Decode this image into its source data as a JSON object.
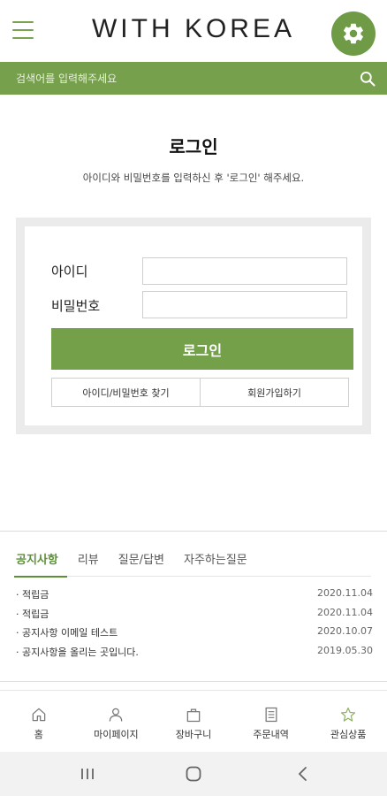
{
  "header": {
    "logo": "WITH KOREA"
  },
  "search": {
    "placeholder": "검색어를 입력해주세요"
  },
  "login": {
    "title": "로그인",
    "description": "아이디와 비밀번호를 입력하신 후 '로그인' 해주세요.",
    "id_label": "아이디",
    "password_label": "비밀번호",
    "button_label": "로그인",
    "find_link": "아이디/비밀번호 찾기",
    "signup_link": "회원가입하기"
  },
  "board": {
    "tabs": [
      {
        "label": "공지사항",
        "active": true
      },
      {
        "label": "리뷰"
      },
      {
        "label": "질문/답변"
      },
      {
        "label": "자주하는질문"
      }
    ],
    "notices": [
      {
        "title": "· 적립금",
        "date": "2020.11.04"
      },
      {
        "title": "· 적립금",
        "date": "2020.11.04"
      },
      {
        "title": "· 공지사항 이메일 테스트",
        "date": "2020.10.07"
      },
      {
        "title": "· 공지사항을 올리는 곳입니다.",
        "date": "2019.05.30"
      }
    ]
  },
  "bottom_nav": {
    "items": [
      {
        "label": "홈",
        "icon": "home-icon"
      },
      {
        "label": "마이페이지",
        "icon": "person-icon"
      },
      {
        "label": "장바구니",
        "icon": "bag-icon"
      },
      {
        "label": "주문내역",
        "icon": "document-icon"
      },
      {
        "label": "관심상품",
        "icon": "star-icon"
      }
    ]
  },
  "colors": {
    "accent": "#74a04a",
    "accent_dark": "#5d8f3a"
  }
}
